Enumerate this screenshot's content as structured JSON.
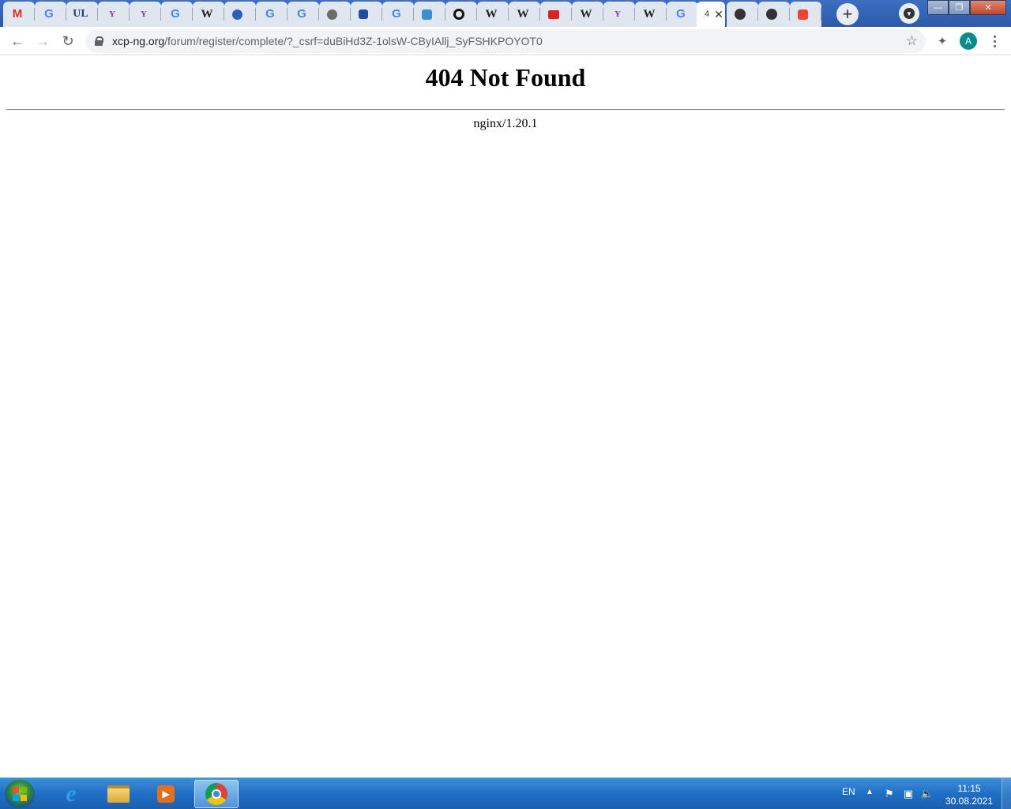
{
  "browser": {
    "tabs": [
      {
        "icon": "gmail-icon",
        "glyph": "M"
      },
      {
        "icon": "google-icon",
        "glyph": "G"
      },
      {
        "icon": "ul-icon",
        "glyph": "UL"
      },
      {
        "icon": "yl-icon",
        "glyph": "Y"
      },
      {
        "icon": "yl-icon",
        "glyph": "Y"
      },
      {
        "icon": "google-icon",
        "glyph": "G"
      },
      {
        "icon": "wikipedia-icon",
        "glyph": "W"
      },
      {
        "icon": "edge-icon",
        "glyph": ""
      },
      {
        "icon": "google-icon",
        "glyph": "G"
      },
      {
        "icon": "google-icon",
        "glyph": "G"
      },
      {
        "icon": "globe-icon",
        "glyph": ""
      },
      {
        "icon": "blue-square-icon",
        "glyph": ""
      },
      {
        "icon": "google-icon",
        "glyph": "G"
      },
      {
        "icon": "gear-icon",
        "glyph": ""
      },
      {
        "icon": "quora-icon",
        "glyph": ""
      },
      {
        "icon": "wikipedia-icon",
        "glyph": "W"
      },
      {
        "icon": "wikipedia-icon",
        "glyph": "W"
      },
      {
        "icon": "red-flag-icon",
        "glyph": ""
      },
      {
        "icon": "wikipedia-icon",
        "glyph": "W"
      },
      {
        "icon": "yl-icon",
        "glyph": "Y"
      },
      {
        "icon": "wikipedia-icon",
        "glyph": "W"
      },
      {
        "icon": "google-icon",
        "glyph": "G"
      }
    ],
    "active_tab": {
      "title": "4",
      "close_glyph": "✕"
    },
    "trailing_tabs": [
      {
        "icon": "github-icon"
      },
      {
        "icon": "dark-circle-icon"
      },
      {
        "icon": "red-monitor-icon"
      }
    ],
    "new_tab_glyph": "+",
    "window_controls": {
      "minimize": "—",
      "maximize": "❐",
      "close": "✕"
    },
    "url_host": "xcp-ng.org",
    "url_path": "/forum/register/complete/?_csrf=duBiHd3Z-1olsW-CByIAllj_SyFSHKPOYOT0",
    "avatar_letter": "A"
  },
  "page": {
    "heading": "404 Not Found",
    "server": "nginx/1.20.1"
  },
  "taskbar": {
    "language": "EN",
    "time": "11:15",
    "date": "30.08.2021"
  },
  "colors": {
    "tabstrip": "#2d5aa8",
    "avatar": "#0b8a8f",
    "taskbar": "#1f6fc4"
  }
}
